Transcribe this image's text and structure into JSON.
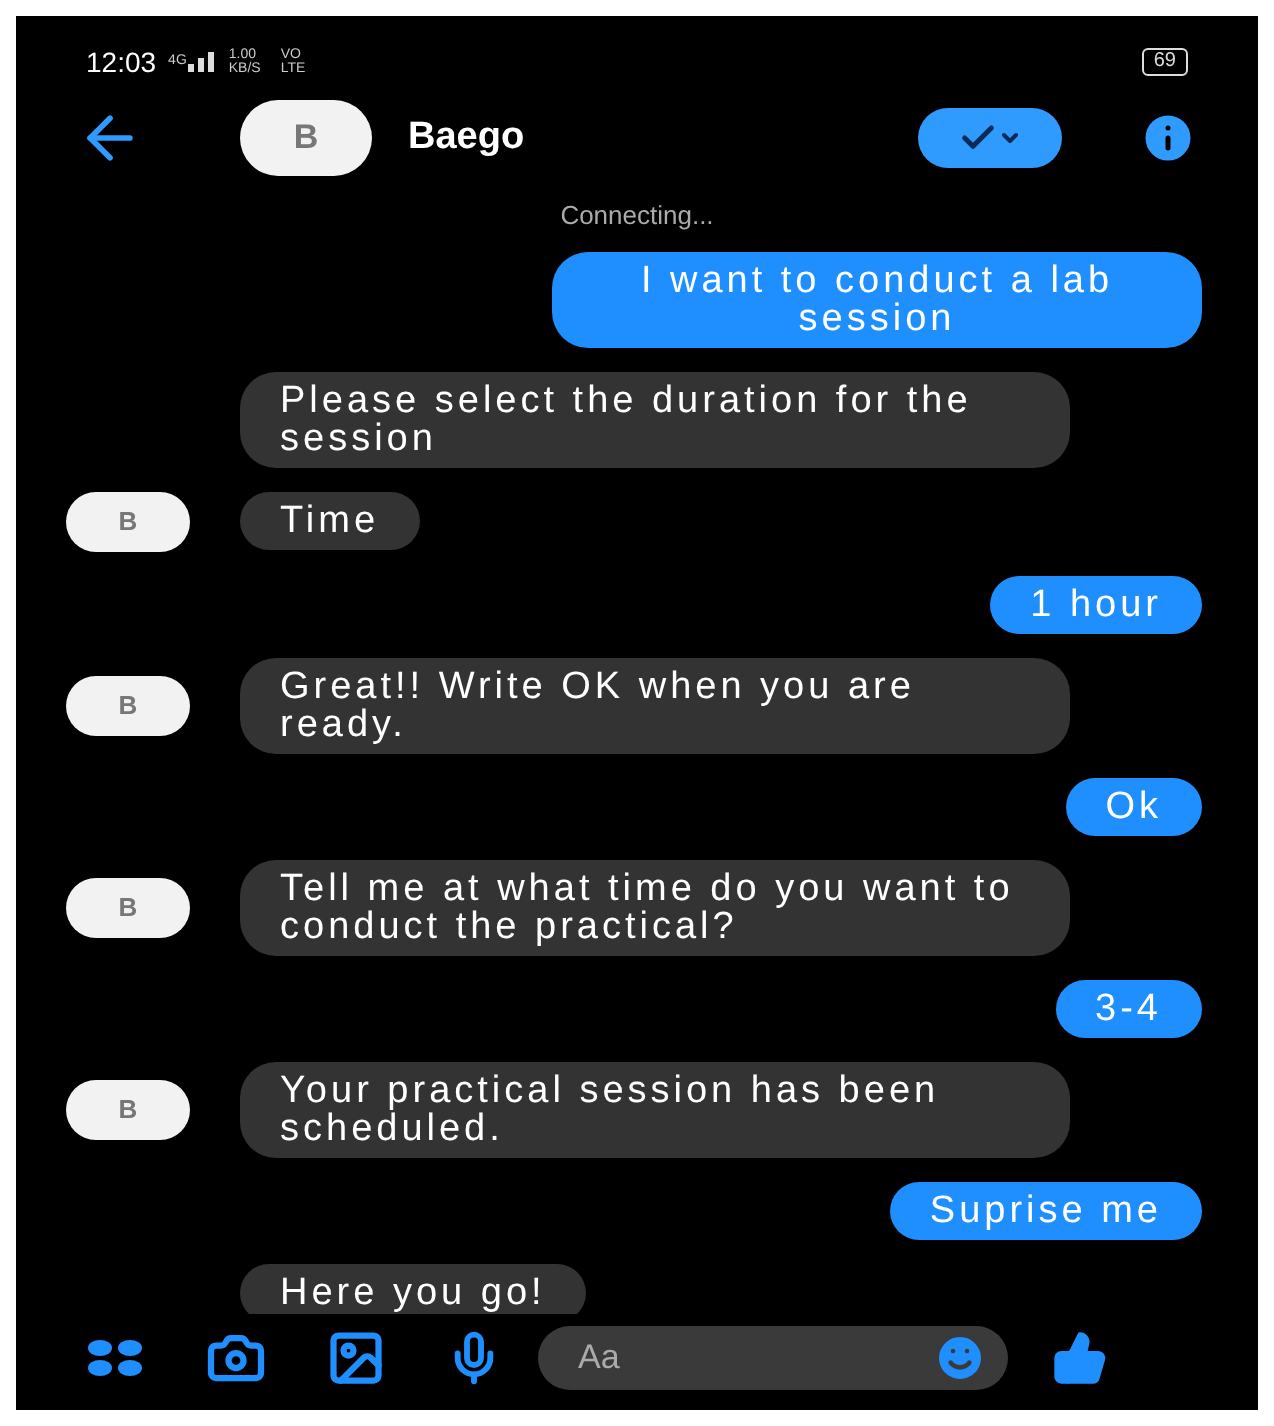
{
  "status_bar": {
    "time": "12:03",
    "network": "4G",
    "speed": "1.00 KB/S",
    "volte": "VO LTE",
    "battery": "69"
  },
  "header": {
    "avatar": "B",
    "name": "Baego"
  },
  "connection_status": "Connecting...",
  "messages": [
    {
      "kind": "outgoing",
      "text": "I want to conduct a lab session"
    },
    {
      "kind": "incoming",
      "text": "Please select the duration for the session",
      "avatar": false
    },
    {
      "kind": "incoming",
      "text": "Time",
      "avatar": true,
      "avatar_letter": "B"
    },
    {
      "kind": "outgoing",
      "text": "1 hour"
    },
    {
      "kind": "incoming",
      "text": "Great!! Write OK when you are ready.",
      "avatar": true,
      "avatar_letter": "B"
    },
    {
      "kind": "outgoing",
      "text": "Ok"
    },
    {
      "kind": "incoming",
      "text": "Tell me at what time do you want to conduct the practical?",
      "avatar": true,
      "avatar_letter": "B"
    },
    {
      "kind": "outgoing",
      "text": "3-4"
    },
    {
      "kind": "incoming",
      "text": "Your practical session has been scheduled.",
      "avatar": true,
      "avatar_letter": "B"
    },
    {
      "kind": "outgoing",
      "text": "Suprise me"
    },
    {
      "kind": "incoming",
      "text": "Here you go!",
      "avatar": false
    }
  ],
  "composer": {
    "placeholder": "Aa"
  }
}
